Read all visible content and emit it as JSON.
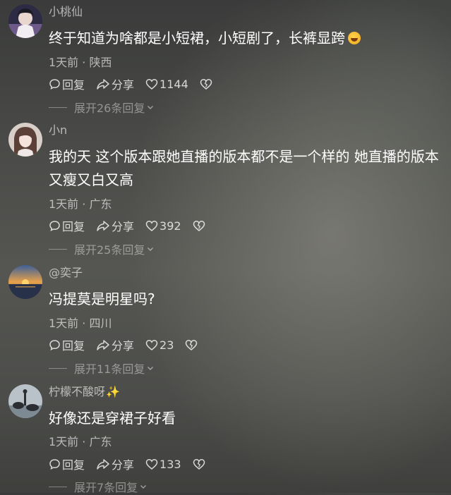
{
  "comments": [
    {
      "username": "小桃仙",
      "text": "终于知道为啥都是小短裙，小短剧了，长裤显跨",
      "emoji": "laughing-emoji",
      "meta": "1天前 · 陕西",
      "reply_label": "回复",
      "share_label": "分享",
      "likes": "1144",
      "expand_label": "展开26条回复"
    },
    {
      "username": "小n",
      "text": "我的天 这个版本跟她直播的版本都不是一个样的 她直播的版本又瘦又白又高",
      "meta": "1天前 · 广东",
      "reply_label": "回复",
      "share_label": "分享",
      "likes": "392",
      "expand_label": "展开25条回复"
    },
    {
      "username": "@奕子",
      "text": "冯提莫是明星吗?",
      "meta": "1天前 · 四川",
      "reply_label": "回复",
      "share_label": "分享",
      "likes": "23",
      "expand_label": "展开11条回复"
    },
    {
      "username": "柠檬不酸呀",
      "username_emoji": "✨",
      "text": "好像还是穿裙子好看",
      "meta": "1天前 · 广东",
      "reply_label": "回复",
      "share_label": "分享",
      "likes": "133",
      "expand_label": "展开7条回复"
    }
  ],
  "icons": {
    "reply": "reply-bubble-icon",
    "share": "share-arrow-icon",
    "like": "heart-icon",
    "dislike": "broken-heart-icon",
    "expand": "chevron-down-icon"
  }
}
